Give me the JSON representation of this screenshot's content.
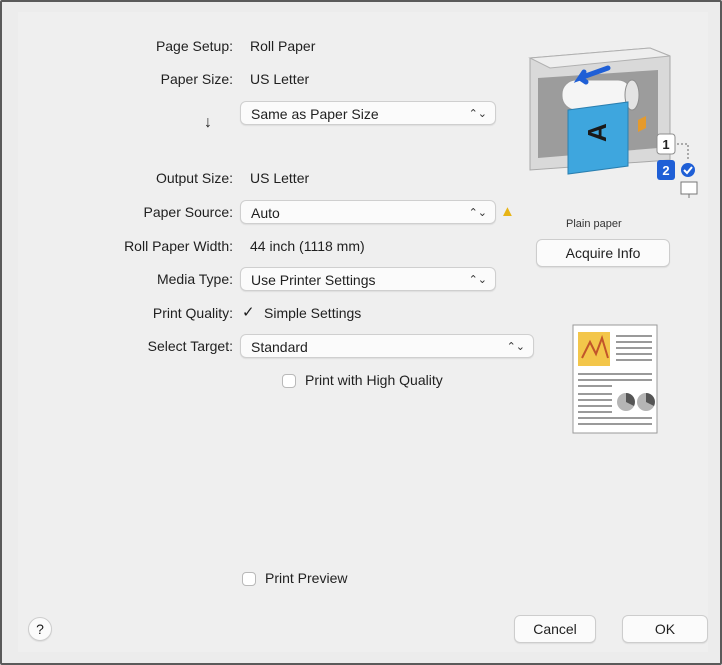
{
  "labels": {
    "page_setup": "Page Setup:",
    "paper_size": "Paper Size:",
    "output_size": "Output Size:",
    "paper_source": "Paper Source:",
    "roll_paper_width": "Roll Paper Width:",
    "media_type": "Media Type:",
    "print_quality": "Print Quality:",
    "select_target": "Select Target:"
  },
  "values": {
    "page_setup": "Roll Paper",
    "paper_size": "US Letter",
    "output_size_popup": "Same as Paper Size",
    "output_size": "US Letter",
    "paper_source": "Auto",
    "roll_paper_width": "44 inch (1118 mm)",
    "media_type": "Use Printer Settings",
    "simple_settings": "Simple Settings",
    "select_target": "Standard",
    "print_high_quality": "Print with High Quality",
    "print_preview": "Print Preview"
  },
  "glyphs": {
    "down_arrow": "↓",
    "chevron": "⌃⌄",
    "warning": "▲",
    "checkmark": "✓"
  },
  "printer": {
    "paper_label": "Plain paper",
    "acquire_info": "Acquire Info",
    "roll_1": "1",
    "roll_2": "2",
    "sheet_letter": "A"
  },
  "buttons": {
    "help": "?",
    "cancel": "Cancel",
    "ok": "OK"
  },
  "state": {
    "simple_settings_checked": true,
    "print_high_quality_checked": false,
    "print_preview_checked": false
  },
  "colors": {
    "warning": "#e7b416",
    "accent_blue": "#1f5fd6",
    "paper_blue": "#3ea6de"
  }
}
